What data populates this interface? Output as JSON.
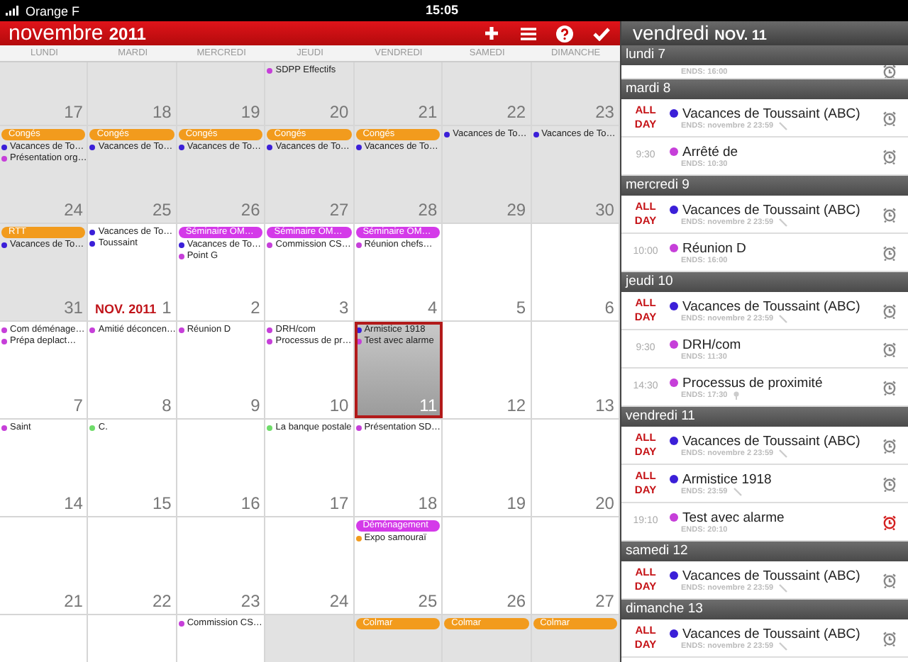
{
  "status_bar": {
    "carrier": "Orange F",
    "time": "15:05"
  },
  "calendar": {
    "month": "novembre",
    "year": "2011",
    "weekdays": [
      "LUNDI",
      "MARDI",
      "MERCREDI",
      "JEUDI",
      "VENDREDI",
      "SAMEDI",
      "DIMANCHE"
    ],
    "weeks": [
      {
        "days": [
          {
            "number": "17",
            "other_month": true,
            "selected": false
          },
          {
            "number": "18",
            "other_month": true,
            "selected": false
          },
          {
            "number": "19",
            "other_month": true,
            "selected": false
          },
          {
            "number": "20",
            "other_month": true,
            "selected": false,
            "events": [
              {
                "kind": "dot",
                "title": "SDPP Effectifs",
                "color": "#c63fd9"
              }
            ]
          },
          {
            "number": "21",
            "other_month": true,
            "selected": false
          },
          {
            "number": "22",
            "other_month": true,
            "selected": false
          },
          {
            "number": "23",
            "other_month": true,
            "selected": false
          }
        ]
      },
      {
        "days": [
          {
            "number": "24",
            "other_month": true,
            "selected": false,
            "events": [
              {
                "kind": "bar",
                "title": "Congés",
                "color": "#f29b1d"
              },
              {
                "kind": "dot",
                "title": "Vacances de To…",
                "color": "#3b1fd8"
              },
              {
                "kind": "dot",
                "title": "Présentation org…",
                "color": "#c63fd9"
              }
            ]
          },
          {
            "number": "25",
            "other_month": true,
            "selected": false,
            "events": [
              {
                "kind": "bar",
                "title": "Congés",
                "color": "#f29b1d"
              },
              {
                "kind": "dot",
                "title": "Vacances de To…",
                "color": "#3b1fd8"
              }
            ]
          },
          {
            "number": "26",
            "other_month": true,
            "selected": false,
            "events": [
              {
                "kind": "bar",
                "title": "Congés",
                "color": "#f29b1d"
              },
              {
                "kind": "dot",
                "title": "Vacances de To…",
                "color": "#3b1fd8"
              }
            ]
          },
          {
            "number": "27",
            "other_month": true,
            "selected": false,
            "events": [
              {
                "kind": "bar",
                "title": "Congés",
                "color": "#f29b1d"
              },
              {
                "kind": "dot",
                "title": "Vacances de To…",
                "color": "#3b1fd8"
              }
            ]
          },
          {
            "number": "28",
            "other_month": true,
            "selected": false,
            "events": [
              {
                "kind": "bar",
                "title": "Congés",
                "color": "#f29b1d"
              },
              {
                "kind": "dot",
                "title": "Vacances de To…",
                "color": "#3b1fd8"
              }
            ]
          },
          {
            "number": "29",
            "other_month": true,
            "selected": false,
            "events": [
              {
                "kind": "dot",
                "title": "Vacances de To…",
                "color": "#3b1fd8"
              }
            ]
          },
          {
            "number": "30",
            "other_month": true,
            "selected": false,
            "events": [
              {
                "kind": "dot",
                "title": "Vacances de To…",
                "color": "#3b1fd8"
              }
            ]
          }
        ]
      },
      {
        "days": [
          {
            "number": "31",
            "other_month": true,
            "selected": false,
            "events": [
              {
                "kind": "bar",
                "title": "RTT",
                "color": "#f29b1d"
              },
              {
                "kind": "dot",
                "title": "Vacances de To…",
                "color": "#3b1fd8"
              }
            ]
          },
          {
            "number": "1",
            "month_label": "NOV. 2011",
            "other_month": false,
            "selected": false,
            "events": [
              {
                "kind": "dot",
                "title": "Vacances de To…",
                "color": "#3b1fd8"
              },
              {
                "kind": "dot",
                "title": "Toussaint",
                "color": "#3b1fd8"
              }
            ]
          },
          {
            "number": "2",
            "other_month": false,
            "selected": false,
            "events": [
              {
                "kind": "bar",
                "title": "Séminaire OM…",
                "color": "#d43ae9"
              },
              {
                "kind": "dot",
                "title": "Vacances de To…",
                "color": "#3b1fd8"
              },
              {
                "kind": "dot",
                "title": "Point G",
                "color": "#c63fd9"
              }
            ]
          },
          {
            "number": "3",
            "other_month": false,
            "selected": false,
            "events": [
              {
                "kind": "bar",
                "title": "Séminaire OM…",
                "color": "#d43ae9"
              },
              {
                "kind": "dot",
                "title": "Commission CS…",
                "color": "#c63fd9"
              }
            ]
          },
          {
            "number": "4",
            "other_month": false,
            "selected": false,
            "events": [
              {
                "kind": "bar",
                "title": "Séminaire OM…",
                "color": "#d43ae9"
              },
              {
                "kind": "dot",
                "title": "Réunion chefs…",
                "color": "#c63fd9"
              }
            ]
          },
          {
            "number": "5",
            "other_month": false,
            "selected": false
          },
          {
            "number": "6",
            "other_month": false,
            "selected": false
          }
        ]
      },
      {
        "days": [
          {
            "number": "7",
            "other_month": false,
            "selected": false,
            "events": [
              {
                "kind": "dot",
                "title": "Com déménage…",
                "color": "#c63fd9"
              },
              {
                "kind": "dot",
                "title": "Prépa deplact…",
                "color": "#c63fd9"
              }
            ]
          },
          {
            "number": "8",
            "other_month": false,
            "selected": false,
            "events": [
              {
                "kind": "dot",
                "title": "Amitié déconcen…",
                "color": "#c63fd9"
              }
            ]
          },
          {
            "number": "9",
            "other_month": false,
            "selected": false,
            "events": [
              {
                "kind": "dot",
                "title": "Réunion D",
                "color": "#c63fd9"
              }
            ]
          },
          {
            "number": "10",
            "other_month": false,
            "selected": false,
            "events": [
              {
                "kind": "dot",
                "title": "DRH/com",
                "color": "#c63fd9"
              },
              {
                "kind": "dot",
                "title": "Processus de pr…",
                "color": "#c63fd9"
              }
            ]
          },
          {
            "number": "11",
            "other_month": false,
            "selected": true,
            "events": [
              {
                "kind": "dot",
                "title": "Armistice 1918",
                "color": "#3b1fd8"
              },
              {
                "kind": "dot",
                "title": "Test avec alarme",
                "color": "#c63fd9"
              }
            ]
          },
          {
            "number": "12",
            "other_month": false,
            "selected": false
          },
          {
            "number": "13",
            "other_month": false,
            "selected": false
          }
        ]
      },
      {
        "days": [
          {
            "number": "14",
            "other_month": false,
            "selected": false,
            "events": [
              {
                "kind": "dot",
                "title": "Saint",
                "color": "#c63fd9"
              }
            ]
          },
          {
            "number": "15",
            "other_month": false,
            "selected": false,
            "events": [
              {
                "kind": "dot",
                "title": "C.",
                "color": "#6fdc6a"
              }
            ]
          },
          {
            "number": "16",
            "other_month": false,
            "selected": false
          },
          {
            "number": "17",
            "other_month": false,
            "selected": false,
            "events": [
              {
                "kind": "dot",
                "title": "La banque postale",
                "color": "#6fdc6a"
              }
            ]
          },
          {
            "number": "18",
            "other_month": false,
            "selected": false,
            "events": [
              {
                "kind": "dot",
                "title": "Présentation SD…",
                "color": "#c63fd9"
              }
            ]
          },
          {
            "number": "19",
            "other_month": false,
            "selected": false
          },
          {
            "number": "20",
            "other_month": false,
            "selected": false
          }
        ]
      },
      {
        "days": [
          {
            "number": "21",
            "other_month": false,
            "selected": false
          },
          {
            "number": "22",
            "other_month": false,
            "selected": false
          },
          {
            "number": "23",
            "other_month": false,
            "selected": false
          },
          {
            "number": "24",
            "other_month": false,
            "selected": false
          },
          {
            "number": "25",
            "other_month": false,
            "selected": false,
            "events": [
              {
                "kind": "bar",
                "title": "Déménagement",
                "color": "#d43ae9"
              },
              {
                "kind": "dot",
                "title": "Expo samouraï",
                "color": "#f29b1d"
              }
            ]
          },
          {
            "number": "26",
            "other_month": false,
            "selected": false
          },
          {
            "number": "27",
            "other_month": false,
            "selected": false
          }
        ]
      },
      {
        "days": [
          {
            "other_month": false,
            "selected": false
          },
          {
            "other_month": false,
            "selected": false
          },
          {
            "other_month": false,
            "selected": false,
            "events": [
              {
                "kind": "dot",
                "title": "Commission CS…",
                "color": "#c63fd9"
              }
            ]
          },
          {
            "other_month": true,
            "selected": false
          },
          {
            "other_month": true,
            "selected": false,
            "events": [
              {
                "kind": "bar",
                "title": "Colmar",
                "color": "#f29b1d"
              }
            ]
          },
          {
            "other_month": true,
            "selected": false,
            "events": [
              {
                "kind": "bar",
                "title": "Colmar",
                "color": "#f29b1d"
              }
            ]
          },
          {
            "other_month": true,
            "selected": false,
            "events": [
              {
                "kind": "bar",
                "title": "Colmar",
                "color": "#f29b1d"
              }
            ]
          }
        ]
      }
    ]
  },
  "agenda": {
    "weekday": "vendredi",
    "date": "NOV. 11",
    "sections": [
      {
        "title": "lundi 7",
        "items": [
          {
            "kind": "partial",
            "ends": "ENDS: 16:00",
            "alarm_on": false
          }
        ]
      },
      {
        "title": "mardi 8",
        "items": [
          {
            "kind": "event",
            "time": "ALL DAY",
            "all_day": true,
            "color": "#3b1fd8",
            "title": "Vacances de Toussaint (ABC)",
            "ends": "ENDS: novembre 2 23:59",
            "editable": true,
            "alarm_on": false
          },
          {
            "kind": "event",
            "time": "9:30",
            "all_day": false,
            "color": "#c63fd9",
            "title": "Arrêté de",
            "ends": "ENDS: 10:30",
            "alarm_on": false
          }
        ]
      },
      {
        "title": "mercredi 9",
        "items": [
          {
            "kind": "event",
            "time": "ALL DAY",
            "all_day": true,
            "color": "#3b1fd8",
            "title": "Vacances de Toussaint (ABC)",
            "ends": "ENDS: novembre 2 23:59",
            "editable": true,
            "alarm_on": false
          },
          {
            "kind": "event",
            "time": "10:00",
            "all_day": false,
            "color": "#c63fd9",
            "title": "Réunion D",
            "ends": "ENDS: 16:00",
            "alarm_on": false
          }
        ]
      },
      {
        "title": "jeudi 10",
        "items": [
          {
            "kind": "event",
            "time": "ALL DAY",
            "all_day": true,
            "color": "#3b1fd8",
            "title": "Vacances de Toussaint (ABC)",
            "ends": "ENDS: novembre 2 23:59",
            "editable": true,
            "alarm_on": false
          },
          {
            "kind": "event",
            "time": "9:30",
            "all_day": false,
            "color": "#c63fd9",
            "title": "DRH/com",
            "ends": "ENDS: 11:30",
            "alarm_on": false
          },
          {
            "kind": "event",
            "time": "14:30",
            "all_day": false,
            "color": "#c63fd9",
            "title": "Processus de proximité",
            "ends": "ENDS: 17:30",
            "has_location": true,
            "alarm_on": false
          }
        ]
      },
      {
        "title": "vendredi 11",
        "items": [
          {
            "kind": "event",
            "time": "ALL DAY",
            "all_day": true,
            "color": "#3b1fd8",
            "title": "Vacances de Toussaint (ABC)",
            "ends": "ENDS: novembre 2 23:59",
            "editable": true,
            "alarm_on": false
          },
          {
            "kind": "event",
            "time": "ALL DAY",
            "all_day": true,
            "color": "#3b1fd8",
            "title": "Armistice 1918",
            "ends": "ENDS: 23:59",
            "editable": true,
            "alarm_on": false
          },
          {
            "kind": "event",
            "time": "19:10",
            "all_day": false,
            "color": "#c63fd9",
            "title": "Test avec alarme",
            "ends": "ENDS: 20:10",
            "alarm_on": true
          }
        ]
      },
      {
        "title": "samedi 12",
        "items": [
          {
            "kind": "event",
            "time": "ALL DAY",
            "all_day": true,
            "color": "#3b1fd8",
            "title": "Vacances de Toussaint (ABC)",
            "ends": "ENDS: novembre 2 23:59",
            "editable": true,
            "alarm_on": false
          }
        ]
      },
      {
        "title": "dimanche 13",
        "items": [
          {
            "kind": "event",
            "time": "ALL DAY",
            "all_day": true,
            "color": "#3b1fd8",
            "title": "Vacances de Toussaint (ABC)",
            "ends": "ENDS: novembre 2 23:59",
            "editable": true,
            "alarm_on": false
          }
        ]
      }
    ]
  }
}
